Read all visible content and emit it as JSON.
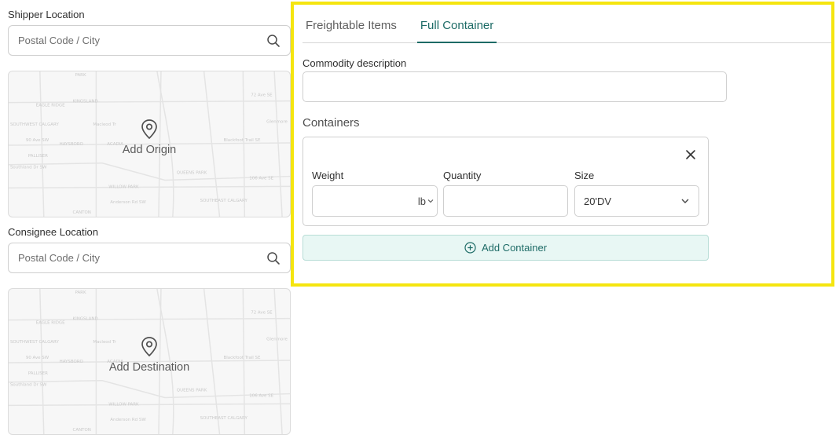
{
  "shipper": {
    "label": "Shipper Location",
    "search_placeholder": "Postal Code / City",
    "map_action": "Add Origin"
  },
  "consignee": {
    "label": "Consignee Location",
    "search_placeholder": "Postal Code / City",
    "map_action": "Add Destination"
  },
  "map_labels": [
    "PARK",
    "EAGLE RIDGE",
    "KINGSLAND",
    "SOUTHWEST CALGARY",
    "HAYSBORO",
    "90 Ave SW",
    "PALLISER",
    "Southland Dr SW",
    "ACADIA",
    "QUEENS PARK",
    "WILLOW PARK",
    "Anderson Rd SW",
    "SOUTHEAST CALGARY",
    "CANTON",
    "72 Ave SE",
    "Glenmore",
    "Blackfoot Trail SE",
    "106 Ave SE",
    "Macleod Tr"
  ],
  "tabs": [
    {
      "label": "Freightable Items",
      "active": false
    },
    {
      "label": "Full Container",
      "active": true
    }
  ],
  "commodity": {
    "label": "Commodity description",
    "value": ""
  },
  "containers": {
    "heading": "Containers",
    "items": [
      {
        "weight_label": "Weight",
        "weight_value": "",
        "weight_unit": "lb",
        "quantity_label": "Quantity",
        "quantity_value": "",
        "size_label": "Size",
        "size_value": "20'DV"
      }
    ],
    "add_label": "Add Container"
  },
  "colors": {
    "accent": "#1d6b66",
    "highlight_border": "#f5e50f",
    "add_button_bg": "#e8f7f4"
  }
}
